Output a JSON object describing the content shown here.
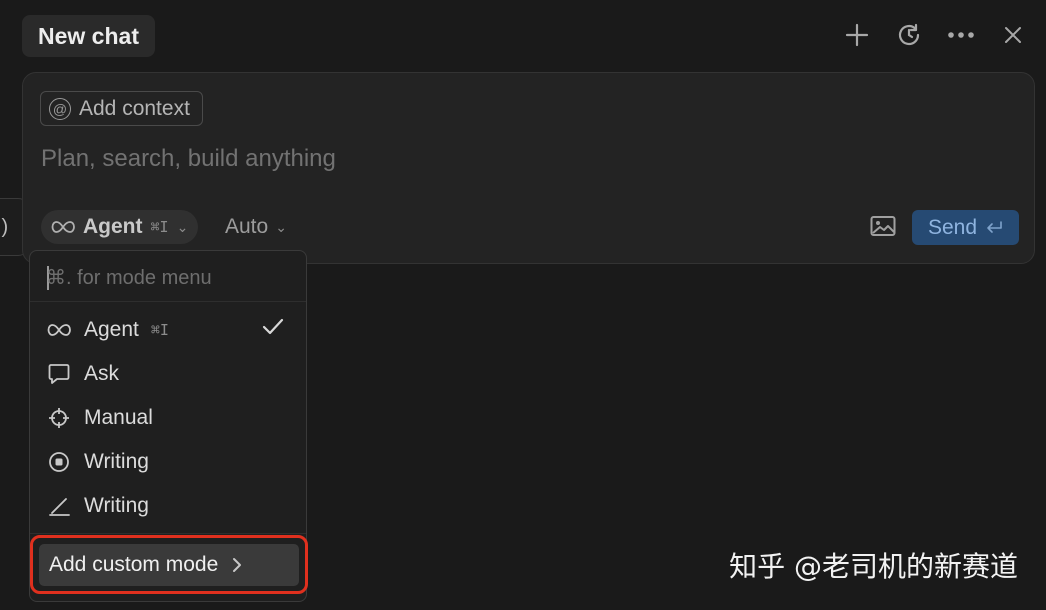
{
  "header": {
    "tab_title": "New chat",
    "actions": [
      {
        "name": "new-chat",
        "icon": "plus-icon"
      },
      {
        "name": "history",
        "icon": "history-icon"
      },
      {
        "name": "more",
        "icon": "more-icon"
      },
      {
        "name": "close",
        "icon": "close-icon"
      }
    ]
  },
  "side_tab": {
    "label": ".)"
  },
  "composer": {
    "context_label": "Add context",
    "context_icon": "at-icon",
    "placeholder": "Plan, search, build anything",
    "mode_label": "Agent",
    "mode_shortcut": "⌘I",
    "model_label": "Auto",
    "send_label": "Send",
    "image_icon": "image-icon"
  },
  "mode_menu": {
    "search_placeholder": "⌘. for mode menu",
    "items": [
      {
        "label": "Agent",
        "shortcut": "⌘I",
        "icon": "infinity-icon",
        "selected": true
      },
      {
        "label": "Ask",
        "icon": "chat-bubble-icon",
        "selected": false
      },
      {
        "label": "Manual",
        "icon": "crosshair-icon",
        "selected": false
      },
      {
        "label": "Writing",
        "icon": "radio-circle-icon",
        "selected": false
      },
      {
        "label": "Writing",
        "icon": "pen-line-icon",
        "selected": false
      }
    ],
    "add_custom_label": "Add custom mode"
  },
  "watermark": "知乎 @老司机的新赛道",
  "colors": {
    "background": "#1a1a1a",
    "send": "#264a73",
    "highlight": "#e0301e"
  }
}
